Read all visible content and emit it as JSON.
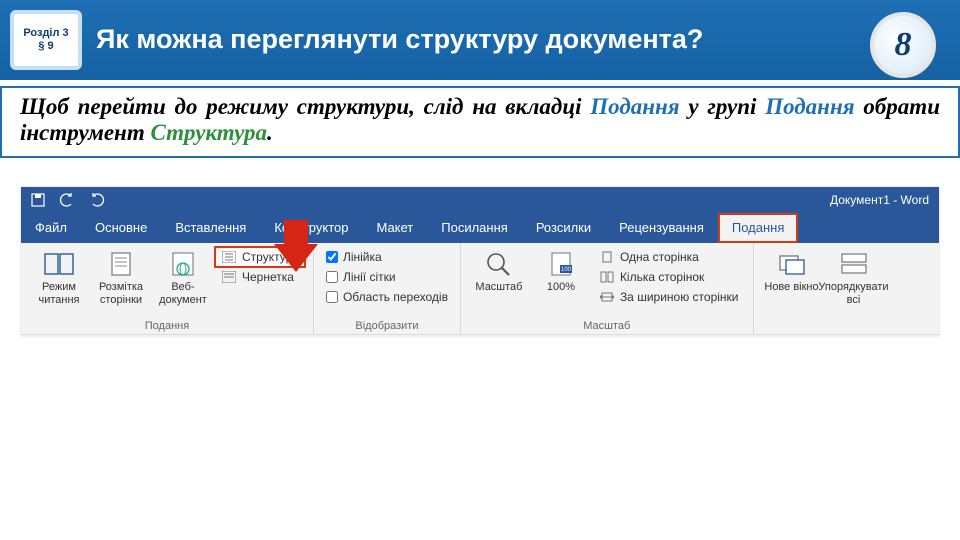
{
  "header": {
    "chapter": "Розділ 3",
    "section": "§ 9",
    "title": "Як можна переглянути структуру документа?",
    "grade": "8"
  },
  "explain": {
    "pre": "Щоб перейти до режиму структури, слід на вкладці ",
    "tab_word": "Подання",
    "mid1": " у групі ",
    "group_word": "Подання",
    "mid2": " обрати інструмент ",
    "tool_word": "Структура",
    "post": "."
  },
  "word": {
    "doc_title": "Документ1 - Word",
    "tabs": {
      "file": "Файл",
      "home": "Основне",
      "insert": "Вставлення",
      "design": "Конструктор",
      "layout": "Макет",
      "references": "Посилання",
      "mailings": "Розсилки",
      "review": "Рецензування",
      "view": "Подання"
    },
    "groups": {
      "views": {
        "label": "Подання",
        "read": "Режим читання",
        "print": "Розмітка сторінки",
        "web": "Веб-документ",
        "outline": "Структура",
        "draft": "Чернетка"
      },
      "show": {
        "label": "Відобразити",
        "ruler": "Лінійка",
        "gridlines": "Лінії сітки",
        "navpane": "Область переходів"
      },
      "zoom": {
        "label": "Масштаб",
        "zoom": "Масштаб",
        "hundred": "100%",
        "onepage": "Одна сторінка",
        "multipage": "Кілька сторінок",
        "pagewidth": "За шириною сторінки"
      },
      "window": {
        "newwin": "Нове вікно",
        "arrange": "Упорядкувати всі"
      }
    }
  }
}
